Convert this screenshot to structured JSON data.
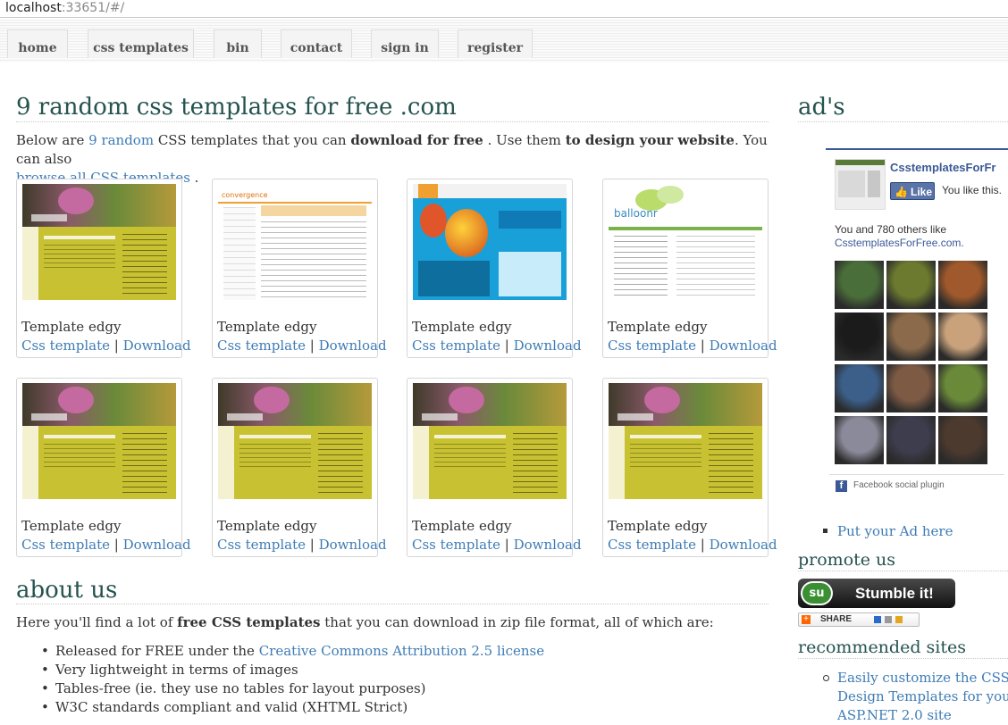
{
  "browser": {
    "host": "localhost",
    "path": ":33651/#/"
  },
  "nav": [
    {
      "label": "home"
    },
    {
      "label": "css templates"
    },
    {
      "label": "bin"
    },
    {
      "label": "contact"
    },
    {
      "label": "sign in"
    },
    {
      "label": "register"
    }
  ],
  "main": {
    "title": "9 random css templates for free .com",
    "intro": {
      "p1": "Below are ",
      "p2": "9",
      "p3": " ",
      "random_link": "random",
      "p4": " CSS templates that you can ",
      "bold1": "download for free",
      "p5": " . Use them ",
      "bold2": "to design your website",
      "p6": ". You can also",
      "browse_link": "browse all CSS templates",
      "p7": " ."
    },
    "templates": [
      {
        "name": "Template edgy",
        "css_link": "Css template",
        "sep": " | ",
        "download": "Download",
        "thumb": "edgy"
      },
      {
        "name": "Template edgy",
        "css_link": "Css template",
        "sep": " | ",
        "download": "Download",
        "thumb": "convergence"
      },
      {
        "name": "Template edgy",
        "css_link": "Css template",
        "sep": " | ",
        "download": "Download",
        "thumb": "balloon"
      },
      {
        "name": "Template edgy",
        "css_link": "Css template",
        "sep": " | ",
        "download": "Download",
        "thumb": "balloonr"
      },
      {
        "name": "Template edgy",
        "css_link": "Css template",
        "sep": " | ",
        "download": "Download",
        "thumb": "edgy"
      },
      {
        "name": "Template edgy",
        "css_link": "Css template",
        "sep": " | ",
        "download": "Download",
        "thumb": "edgy"
      },
      {
        "name": "Template edgy",
        "css_link": "Css template",
        "sep": " | ",
        "download": "Download",
        "thumb": "edgy"
      },
      {
        "name": "Template edgy",
        "css_link": "Css template",
        "sep": " | ",
        "download": "Download",
        "thumb": "edgy"
      }
    ],
    "about": {
      "title": "about us",
      "p1": "Here you'll find a lot of ",
      "bold": "free CSS templates",
      "p2": " that you can download in zip file format, all of which are:",
      "items": [
        {
          "text": "Released for FREE under the ",
          "link": "Creative Commons Attribution 2.5 license"
        },
        {
          "text": "Very lightweight in terms of images",
          "link": ""
        },
        {
          "text": "Tables-free (ie. they use no tables for layout purposes)",
          "link": ""
        },
        {
          "text": "W3C standards compliant and valid (XHTML Strict)",
          "link": ""
        }
      ]
    }
  },
  "sidebar": {
    "ads_title": "ad's",
    "fb": {
      "page_name": "CsstemplatesForFr",
      "like_label": "Like",
      "you_like": "You like this.",
      "others_line1": "You and 780 others like",
      "others_line2": "CsstemplatesForFree.com.",
      "plugin_label": "Facebook social plugin",
      "face_colors": [
        "#4a6e3a",
        "#6b7a2f",
        "#a0592c",
        "#1b1b1b",
        "#8a6a4a",
        "#c9a27c",
        "#3c5f8a",
        "#7d5a44",
        "#6a8a3a",
        "#8a8a9a",
        "#3d3d4d",
        "#4d3a2e"
      ]
    },
    "put_ad": "Put your Ad here",
    "promote_title": "promote us",
    "stumble_label": "Stumble it!",
    "share_label": "SHARE",
    "recommended_title": "recommended sites",
    "recommended": [
      "Easily customize the CSS",
      "Design Templates for your",
      "ASP.NET 2.0 site"
    ]
  },
  "colors": {
    "heading": "#25534f",
    "link": "#3e7cb6"
  }
}
